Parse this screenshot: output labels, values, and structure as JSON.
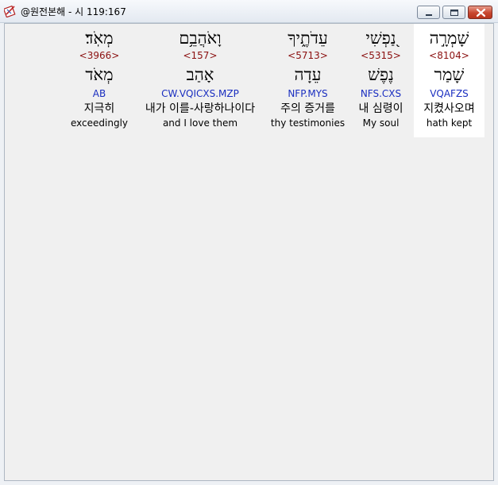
{
  "window": {
    "title": "@원전본해 - 시 119:167",
    "icon": "bible-app-icon"
  },
  "words": [
    {
      "hebrew": "מְאֹֽד׃",
      "strongs": "<3966>",
      "lemma": "מְאֹד",
      "translit": "AB",
      "korean": "지극히",
      "english": "exceedingly",
      "highlight": false
    },
    {
      "hebrew": "וָאֹהֲבֵ֥ם",
      "strongs": "<157>",
      "lemma": "אָהַב",
      "translit": "CW.VQICXS.MZP",
      "korean": "내가 이를-사랑하나이다",
      "english": "and I love them",
      "highlight": false
    },
    {
      "hebrew": "עֵדֹתֶ֑יךָ",
      "strongs": "<5713>",
      "lemma": "עֵדָה",
      "translit": "NFP.MYS",
      "korean": "주의 증거를",
      "english": "thy testimonies",
      "highlight": false
    },
    {
      "hebrew": "נַ֭פְשִׁי",
      "strongs": "<5315>",
      "lemma": "נֶפֶשׁ",
      "translit": "NFS.CXS",
      "korean": "내 심령이",
      "english": "My soul",
      "highlight": false
    },
    {
      "hebrew": "שָׁמְרָ֣ה",
      "strongs": "<8104>",
      "lemma": "שָׁמַר",
      "translit": "VQAFZS",
      "korean": "지켰사오며",
      "english": "hath kept",
      "highlight": true
    }
  ],
  "colors": {
    "strongs": "#8b1010",
    "translit": "#1a2ec0",
    "highlight_bg": "#ffffff"
  }
}
